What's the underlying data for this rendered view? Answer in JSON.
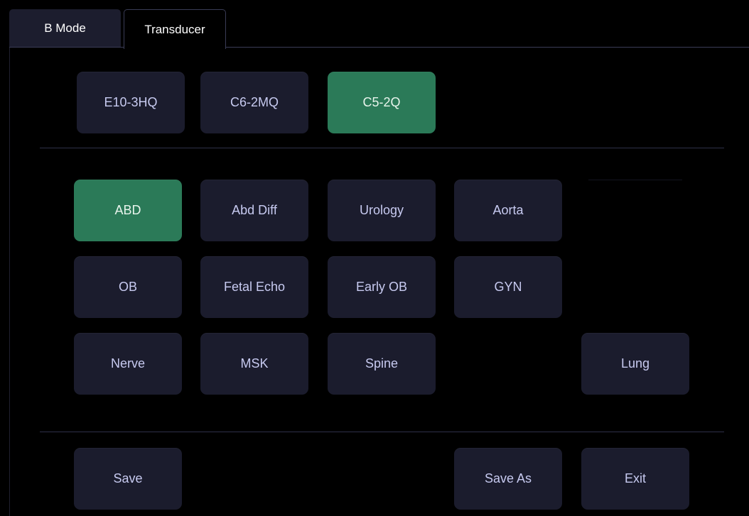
{
  "tabs": {
    "b_mode": "B Mode",
    "transducer": "Transducer"
  },
  "transducers": {
    "t1": "E10-3HQ",
    "t2": "C6-2MQ",
    "t3": "C5-2Q"
  },
  "presets": {
    "abd": "ABD",
    "abd_diff": "Abd Diff",
    "urology": "Urology",
    "aorta": "Aorta",
    "ob": "OB",
    "fetal_echo": "Fetal Echo",
    "early_ob": "Early OB",
    "gyn": "GYN",
    "nerve": "Nerve",
    "msk": "MSK",
    "spine": "Spine",
    "lung": "Lung"
  },
  "actions": {
    "save": "Save",
    "save_as": "Save As",
    "exit": "Exit"
  },
  "selected": {
    "transducer": "C5-2Q",
    "preset": "ABD"
  },
  "colors": {
    "background": "#000000",
    "button": "#1b1c2d",
    "selected": "#2b7a58",
    "text": "#c7caf0"
  }
}
